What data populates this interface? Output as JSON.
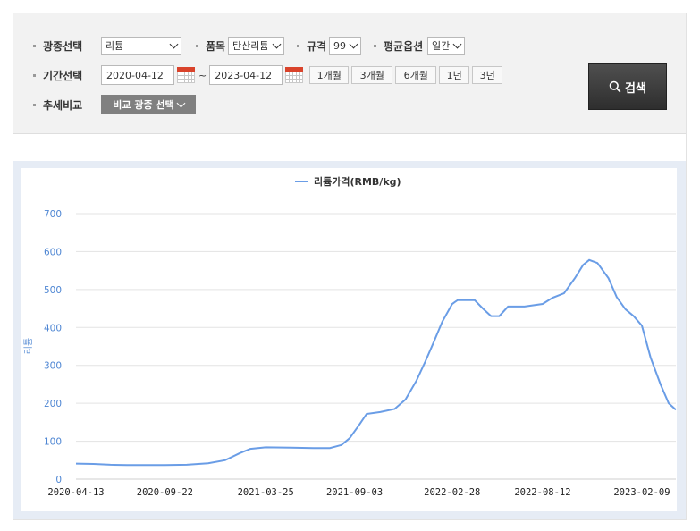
{
  "search": {
    "mineral_label": "광종선택",
    "mineral_value": "리튬",
    "item_label": "품목",
    "item_value": "탄산리튬",
    "spec_label": "규격",
    "spec_value": "99",
    "avg_label": "평균옵션",
    "avg_value": "일간",
    "period_label": "기간선택",
    "start_date": "2020-04-12",
    "tilde": "~",
    "end_date": "2023-04-12",
    "period_buttons": [
      "1개월",
      "3개월",
      "6개월",
      "1년",
      "3년"
    ],
    "trend_label": "추세비교",
    "compare_button": "비교 광종 선택",
    "search_button": "검색"
  },
  "chart_data": {
    "type": "line",
    "legend": "리튬가격(RMB/kg)",
    "legend_position": "top-center",
    "ylabel": "리튬",
    "ylim": [
      0,
      700
    ],
    "yticks": [
      0,
      100,
      200,
      300,
      400,
      500,
      600,
      700
    ],
    "grid": true,
    "line_color": "#6a9de6",
    "x_tick_labels": [
      "2020-04-13",
      "2020-09-22",
      "2021-03-25",
      "2021-09-03",
      "2022-02-28",
      "2022-08-12",
      "2023-02-09"
    ],
    "series": [
      {
        "name": "리튬가격(RMB/kg)",
        "points": [
          [
            "2020-04-13",
            41
          ],
          [
            "2020-05-15",
            40
          ],
          [
            "2020-06-15",
            38
          ],
          [
            "2020-07-15",
            37
          ],
          [
            "2020-09-22",
            37
          ],
          [
            "2020-11-01",
            38
          ],
          [
            "2020-12-10",
            42
          ],
          [
            "2021-01-10",
            50
          ],
          [
            "2021-02-05",
            68
          ],
          [
            "2021-02-25",
            80
          ],
          [
            "2021-03-25",
            84
          ],
          [
            "2021-05-10",
            83
          ],
          [
            "2021-06-20",
            82
          ],
          [
            "2021-07-20",
            82
          ],
          [
            "2021-08-10",
            90
          ],
          [
            "2021-08-25",
            108
          ],
          [
            "2021-09-10",
            140
          ],
          [
            "2021-09-25",
            172
          ],
          [
            "2021-10-20",
            177
          ],
          [
            "2021-11-15",
            185
          ],
          [
            "2021-12-05",
            210
          ],
          [
            "2021-12-25",
            260
          ],
          [
            "2022-01-10",
            310
          ],
          [
            "2022-01-25",
            360
          ],
          [
            "2022-02-10",
            415
          ],
          [
            "2022-02-28",
            462
          ],
          [
            "2022-03-10",
            472
          ],
          [
            "2022-04-10",
            472
          ],
          [
            "2022-04-25",
            450
          ],
          [
            "2022-05-10",
            430
          ],
          [
            "2022-05-25",
            430
          ],
          [
            "2022-06-10",
            455
          ],
          [
            "2022-07-10",
            455
          ],
          [
            "2022-08-12",
            462
          ],
          [
            "2022-08-30",
            478
          ],
          [
            "2022-09-20",
            490
          ],
          [
            "2022-10-10",
            530
          ],
          [
            "2022-10-25",
            565
          ],
          [
            "2022-11-05",
            578
          ],
          [
            "2022-11-20",
            570
          ],
          [
            "2022-12-10",
            530
          ],
          [
            "2022-12-25",
            480
          ],
          [
            "2023-01-10",
            448
          ],
          [
            "2023-01-25",
            430
          ],
          [
            "2023-02-09",
            405
          ],
          [
            "2023-02-25",
            320
          ],
          [
            "2023-03-15",
            250
          ],
          [
            "2023-03-30",
            200
          ],
          [
            "2023-04-12",
            183
          ]
        ]
      }
    ]
  }
}
